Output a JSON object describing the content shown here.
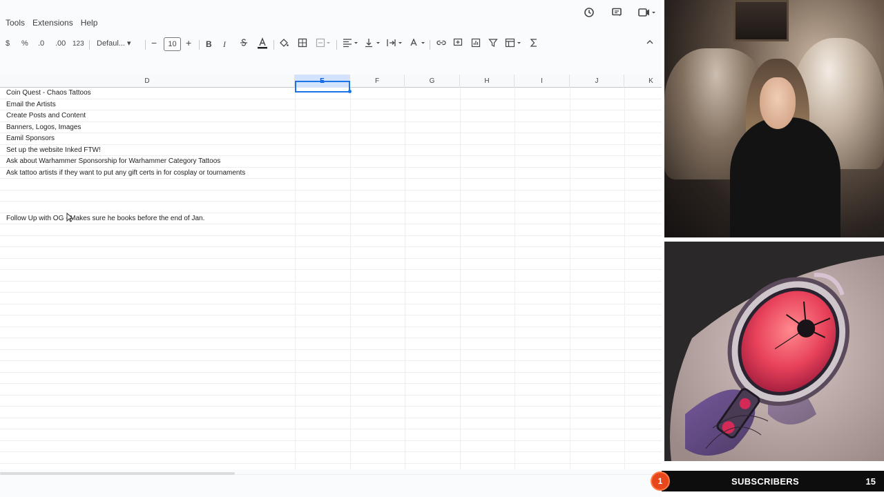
{
  "menu": {
    "tools": "Tools",
    "extensions": "Extensions",
    "help": "Help"
  },
  "toolbar": {
    "currency": "$",
    "percent": "%",
    "decrease_decimal": ".0",
    "increase_decimal": ".00",
    "number_format": "123",
    "font": "Defaul...",
    "font_size": "10",
    "minus": "−",
    "plus": "+",
    "bold": "B",
    "italic": "I"
  },
  "columns": [
    "D",
    "E",
    "F",
    "G",
    "H",
    "I",
    "J",
    "K"
  ],
  "selected_column": "E",
  "rows": [
    "Coin Quest - Chaos Tattoos",
    "Email the Artists",
    "Create Posts and Content",
    "Banners, Logos, Images",
    "Eamil Sponsors",
    "Set up the website Inked FTW!",
    "Ask about Warhammer Sponsorship for Warhammer Category Tattoos",
    "Ask tattoo artists if they want to put any gift certs in for cosplay or tournaments",
    "",
    "",
    "",
    "Follow Up with OG - Makes sure he books before the end of Jan."
  ],
  "stream": {
    "subscribers_label": "SUBSCRIBERS",
    "subscribers_count": "15",
    "badge": "1"
  },
  "icons": {
    "history": "history-icon",
    "comment": "comment-icon",
    "meet": "video-camera-icon"
  }
}
